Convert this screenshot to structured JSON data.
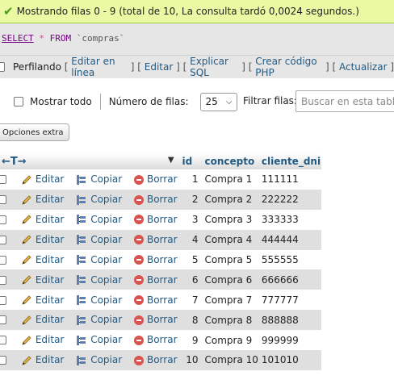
{
  "success": {
    "message": "Mostrando filas 0 - 9 (total de 10, La consulta tardó 0,0024 segundos.)"
  },
  "sql": {
    "select": "SELECT",
    "star": "*",
    "from": "FROM",
    "table": "`compras`"
  },
  "links": {
    "profiling": "Perfilando",
    "items": [
      "Editar en línea",
      "Editar",
      "Explicar SQL",
      "Crear código PHP",
      "Actualizar"
    ]
  },
  "toolbar": {
    "show_all": "Mostrar todo",
    "rows_label": "Número de filas:",
    "rows_value": "25",
    "filter_label": "Filtrar filas:",
    "search_placeholder": "Buscar en esta tabla"
  },
  "extra_options": "Opciones extra",
  "columns": {
    "arrows": "←T→",
    "id": "id",
    "concepto": "concepto",
    "cliente_dni": "cliente_dni"
  },
  "actions": {
    "edit": "Editar",
    "copy": "Copiar",
    "delete": "Borrar"
  },
  "rows": [
    {
      "id": "1",
      "concepto": "Compra 1",
      "cliente_dni": "111111"
    },
    {
      "id": "2",
      "concepto": "Compra 2",
      "cliente_dni": "222222"
    },
    {
      "id": "3",
      "concepto": "Compra 3",
      "cliente_dni": "333333"
    },
    {
      "id": "4",
      "concepto": "Compra 4",
      "cliente_dni": "444444"
    },
    {
      "id": "5",
      "concepto": "Compra 5",
      "cliente_dni": "555555"
    },
    {
      "id": "6",
      "concepto": "Compra 6",
      "cliente_dni": "666666"
    },
    {
      "id": "7",
      "concepto": "Compra 7",
      "cliente_dni": "777777"
    },
    {
      "id": "8",
      "concepto": "Compra 8",
      "cliente_dni": "888888"
    },
    {
      "id": "9",
      "concepto": "Compra 9",
      "cliente_dni": "999999"
    },
    {
      "id": "10",
      "concepto": "Compra 10",
      "cliente_dni": "101010"
    }
  ]
}
